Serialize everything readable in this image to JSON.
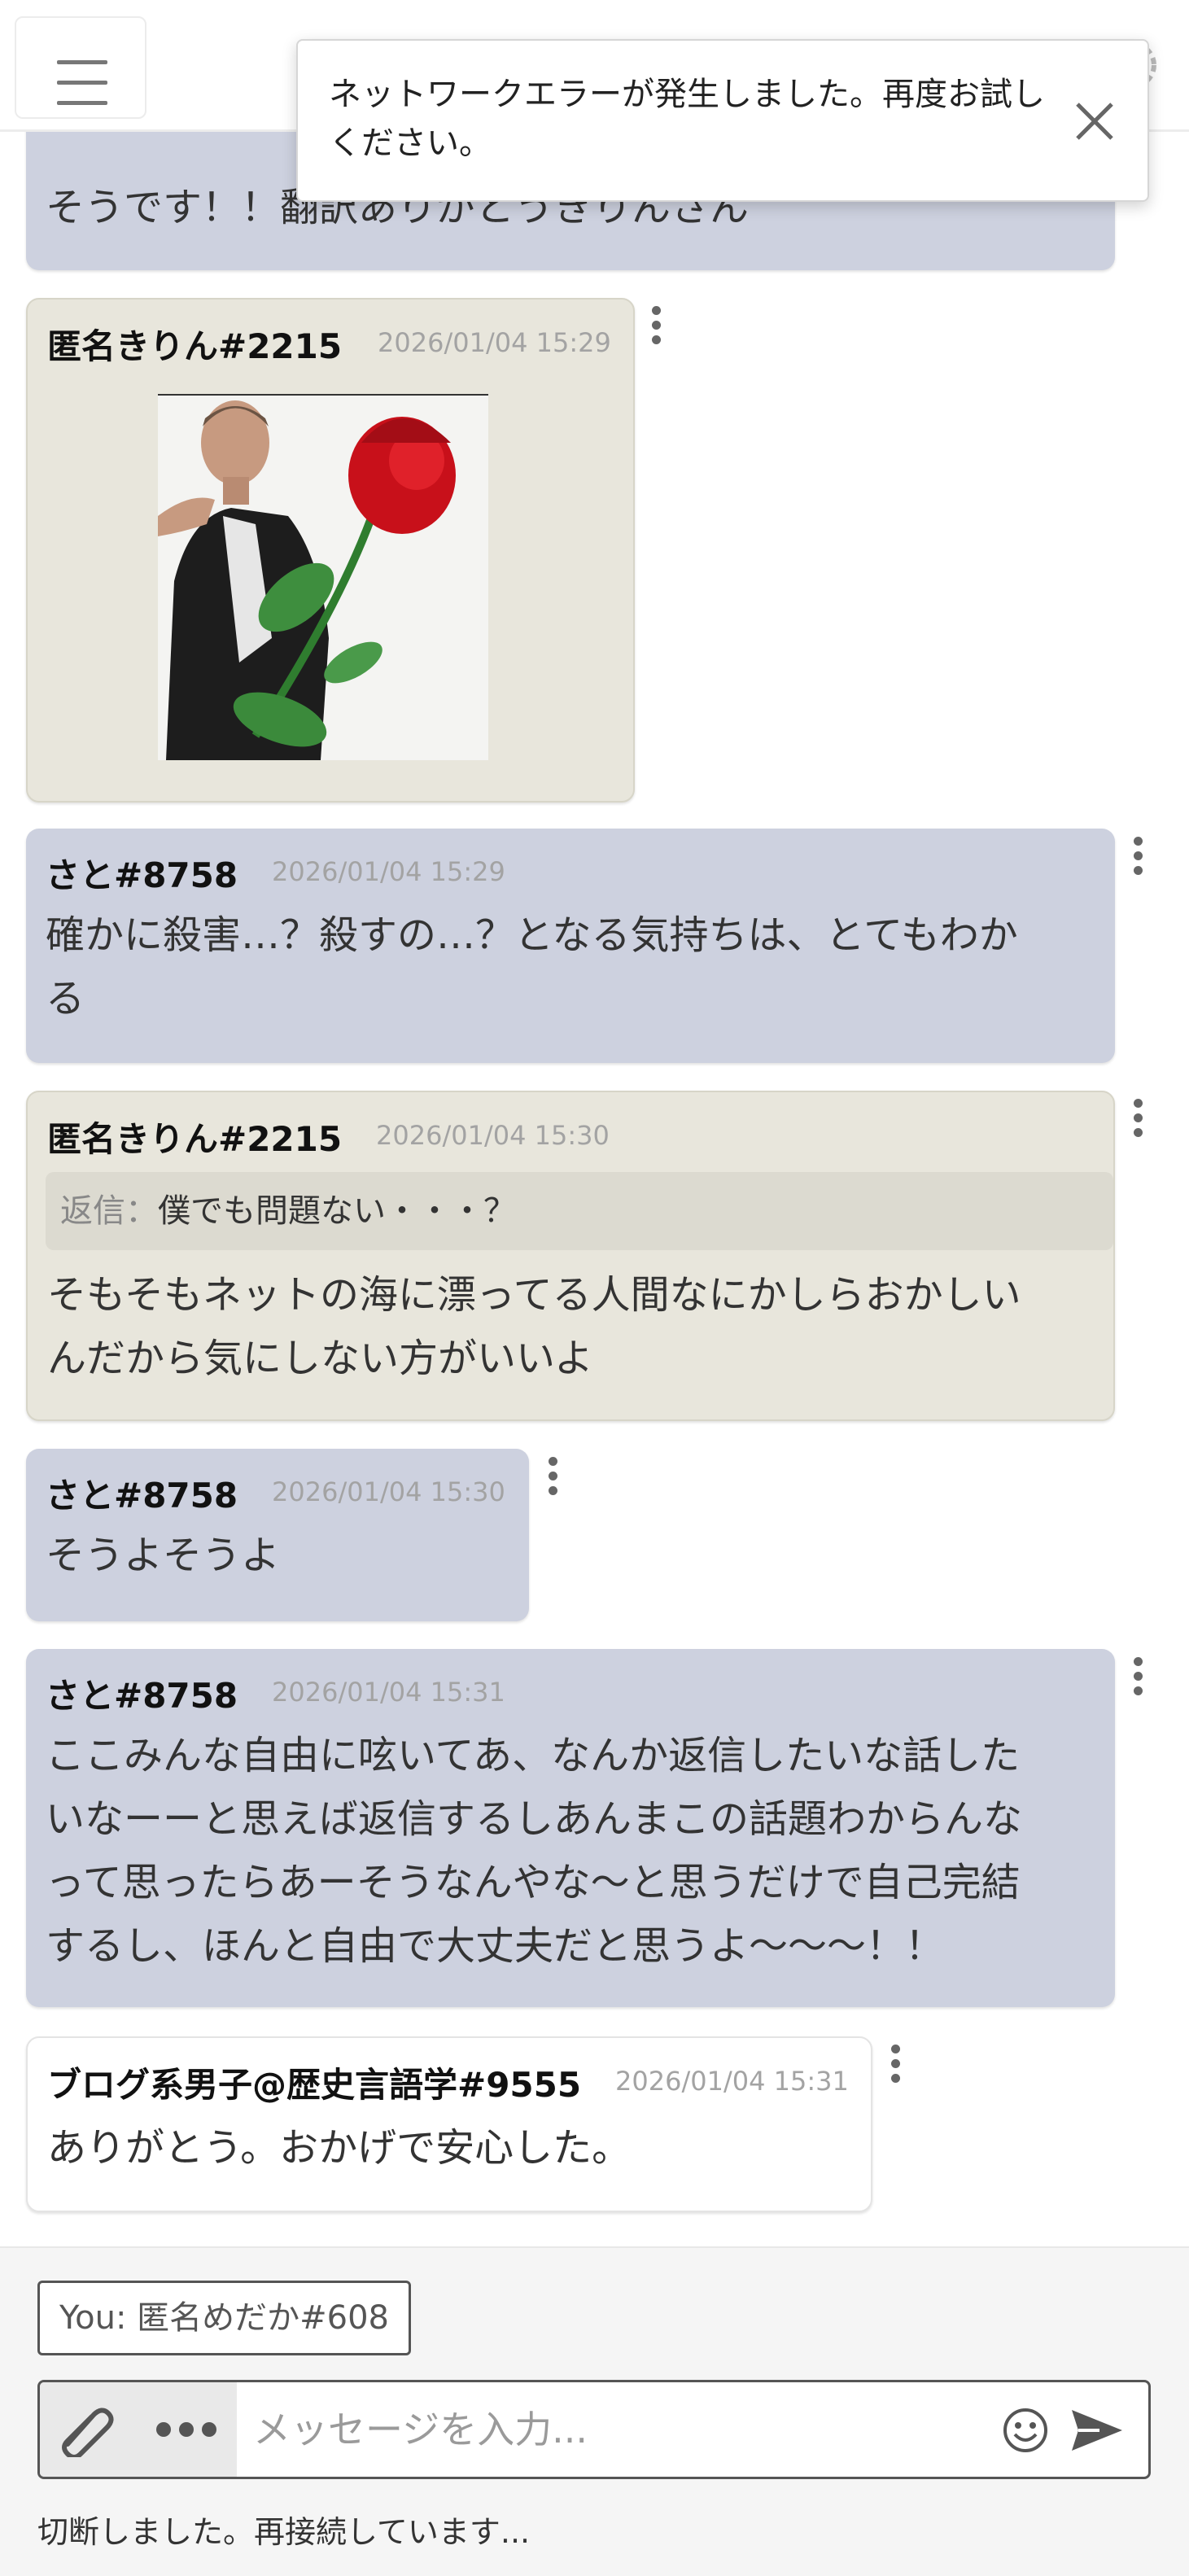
{
  "toast": {
    "message": "ネットワークエラーが発生しました。再度お試しください。"
  },
  "messages": [
    {
      "body": "そうです！！翻訳ありがとうきりんさん"
    },
    {
      "author": "匿名きりん#2215",
      "time": "2026/01/04 15:29",
      "image": "man-with-red-rose-image"
    },
    {
      "author": "さと#8758",
      "time": "2026/01/04 15:29",
      "body_lines": [
        "確かに殺害…？殺すの…？となる気持ちは、とてもわか",
        "る"
      ]
    },
    {
      "author": "匿名きりん#2215",
      "time": "2026/01/04 15:30",
      "reply_label": "返信：",
      "reply_text": "僕でも問題ない・・・？",
      "body_lines": [
        "そもそもネットの海に漂ってる人間なにかしらおかしい",
        "んだから気にしない方がいいよ"
      ]
    },
    {
      "author": "さと#8758",
      "time": "2026/01/04 15:30",
      "body": "そうよそうよ"
    },
    {
      "author": "さと#8758",
      "time": "2026/01/04 15:31",
      "body_lines": [
        "ここみんな自由に呟いてあ、なんか返信したいな話した",
        "いなーーと思えば返信するしあんまこの話題わからんな",
        "って思ったらあーそうなんやな〜と思うだけで自己完結",
        "するし、ほんと自由で大丈夫だと思うよ〜〜〜！！"
      ]
    },
    {
      "author": "ブログ系男子@歴史言語学#9555",
      "time": "2026/01/04 15:31",
      "body": "ありがとう。おかげで安心した。"
    }
  ],
  "composer": {
    "you_label": "You: 匿名めだか#608",
    "placeholder": "メッセージを入力...",
    "status": "切断しました。再接続しています..."
  },
  "colors": {
    "own_bubble": "#cdd1df",
    "kirin_bubble": "#e8e6dc",
    "blog_bubble": "#ffffff"
  }
}
